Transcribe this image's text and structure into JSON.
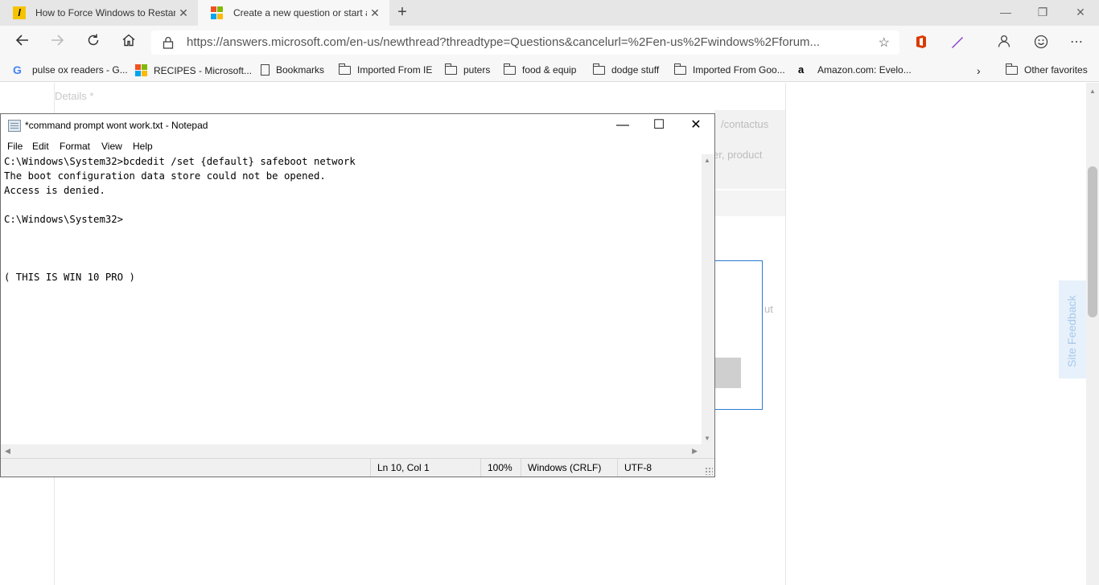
{
  "browser": {
    "tabs": [
      {
        "title": "How to Force Windows to Restar",
        "active": false
      },
      {
        "title": "Create a new question or start a",
        "active": true
      }
    ],
    "url": "https://answers.microsoft.com/en-us/newthread?threadtype=Questions&cancelurl=%2Fen-us%2Fwindows%2Fforum...",
    "favorites": [
      {
        "label": "pulse ox readers - G...",
        "icon": "google-icon"
      },
      {
        "label": "RECIPES - Microsoft...",
        "icon": "microsoft-icon"
      },
      {
        "label": "Bookmarks",
        "icon": "page-icon"
      },
      {
        "label": "Imported From IE",
        "icon": "folder-icon"
      },
      {
        "label": "puters",
        "icon": "folder-icon"
      },
      {
        "label": "food & equip",
        "icon": "folder-icon"
      },
      {
        "label": "dodge stuff",
        "icon": "folder-icon"
      },
      {
        "label": "Imported From Goo...",
        "icon": "folder-icon"
      },
      {
        "label": "Amazon.com: Evelo...",
        "icon": "amazon-icon"
      }
    ],
    "other_favorites": "Other favorites"
  },
  "page": {
    "details_label": "Details *",
    "contact_fragment": "/contactus",
    "product_fragment": "er, product",
    "ut_fragment": "ut",
    "site_feedback": "Site Feedback"
  },
  "notepad": {
    "title": "*command prompt wont work.txt - Notepad",
    "menu": [
      "File",
      "Edit",
      "Format",
      "View",
      "Help"
    ],
    "content": "C:\\Windows\\System32>bcdedit /set {default} safeboot network\nThe boot configuration data store could not be opened.\nAccess is denied.\n\nC:\\Windows\\System32>\n\n\n\n( THIS IS WIN 10 PRO )",
    "status": {
      "position": "Ln 10, Col 1",
      "zoom": "100%",
      "line_ending": "Windows (CRLF)",
      "encoding": "UTF-8"
    }
  },
  "colors": {
    "tabstrip_bg": "#e6e6e6",
    "toolbar_bg": "#f7f7f7",
    "accent_blue": "#2b7bd1"
  }
}
